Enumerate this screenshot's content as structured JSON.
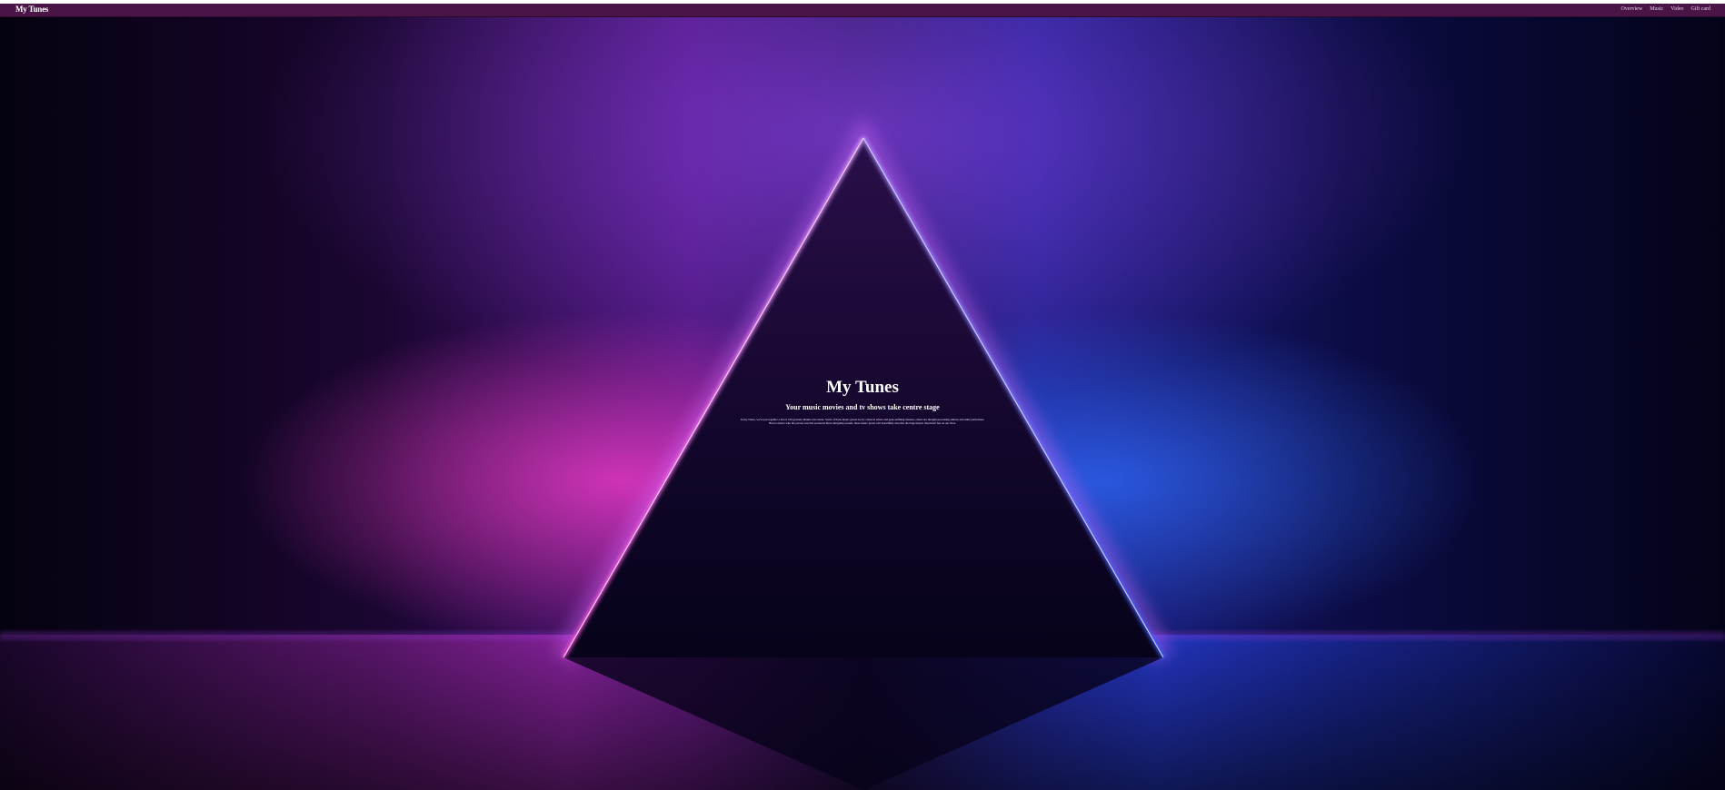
{
  "header": {
    "brand": "My Tunes",
    "nav": [
      {
        "label": "Overview"
      },
      {
        "label": "Music"
      },
      {
        "label": "Video"
      },
      {
        "label": "Gift card"
      }
    ]
  },
  "hero": {
    "title": "My Tunes",
    "subtitle": "Your music movies and tv shows take centre stage",
    "body": "In my Tunes, we've put together a list of 100 greatest albums ever made. Some of these music greats are by classical artists and gene-defining masters, others are thought-provoking authors and other performers. But no matter who the person was that produced these intriguing sounds, these music greats will beautifully describe the huge impact that music has on our lives."
  },
  "colors": {
    "header_bg": "#4a1546",
    "glow_pink": "#ff4fd8",
    "glow_blue": "#3a5bff",
    "background": "#030214"
  }
}
